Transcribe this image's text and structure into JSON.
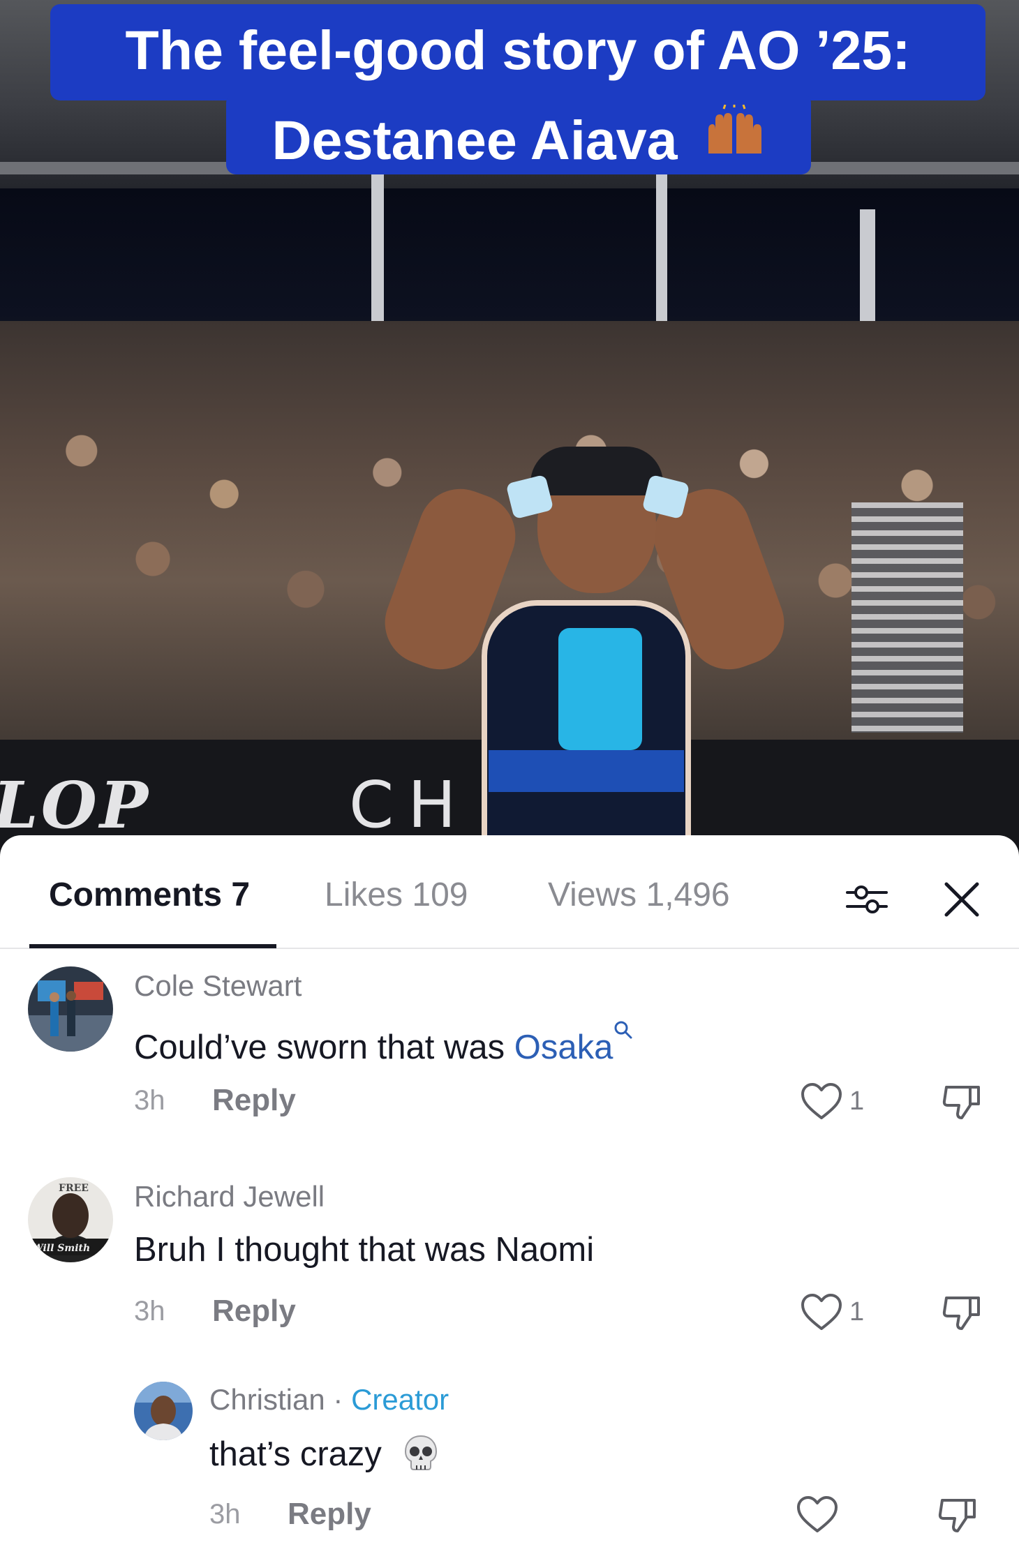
{
  "video": {
    "caption_line1": "The feel-good story of AO ’25:",
    "caption_line2": "Destanee Aiava",
    "caption_emoji": "raising-hands-emoji",
    "wall_text_left": "LOP",
    "wall_text_right": "CH    BB"
  },
  "tabs": [
    {
      "label": "Comments 7",
      "active": true
    },
    {
      "label": "Likes 109",
      "active": false
    },
    {
      "label": "Views 1,496",
      "active": false
    }
  ],
  "icons": {
    "filter": "filter-sliders-icon",
    "close": "close-icon",
    "like": "heart-icon",
    "dislike": "thumbs-down-icon",
    "search": "search-icon",
    "skull": "skull-emoji"
  },
  "comments": [
    {
      "author": "Cole Stewart",
      "text_before": "Could’ve sworn that was ",
      "mention": "Osaka",
      "time": "3h",
      "reply": "Reply",
      "likes": "1"
    },
    {
      "author": "Richard Jewell",
      "text": "Bruh I thought that was Naomi",
      "avatar_text_top": "FREE",
      "avatar_text_bottom": "Will Smith",
      "time": "3h",
      "reply": "Reply",
      "likes": "1"
    },
    {
      "author": "Christian",
      "separator": " · ",
      "badge": "Creator",
      "text": "that’s crazy",
      "time": "3h",
      "reply": "Reply",
      "likes": ""
    }
  ],
  "colors": {
    "caption_bg": "#1c3cc3",
    "mention": "#2c5fb5",
    "creator_badge": "#2b9bd6",
    "text_primary": "#161823",
    "text_secondary": "#7a7b82"
  }
}
